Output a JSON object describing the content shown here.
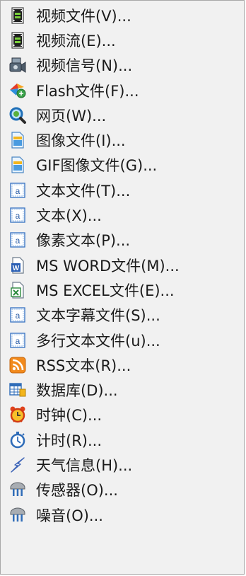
{
  "menu": {
    "items": [
      {
        "label": "视频文件(V)...",
        "icon": "video-file-icon"
      },
      {
        "label": "视频流(E)...",
        "icon": "video-stream-icon"
      },
      {
        "label": "视频信号(N)...",
        "icon": "video-signal-icon"
      },
      {
        "label": "Flash文件(F)...",
        "icon": "flash-file-icon"
      },
      {
        "label": "网页(W)...",
        "icon": "web-page-icon"
      },
      {
        "label": "图像文件(I)...",
        "icon": "image-file-icon"
      },
      {
        "label": "GIF图像文件(G)...",
        "icon": "gif-file-icon"
      },
      {
        "label": "文本文件(T)...",
        "icon": "text-file-icon"
      },
      {
        "label": "文本(X)...",
        "icon": "text-icon"
      },
      {
        "label": "像素文本(P)...",
        "icon": "pixel-text-icon"
      },
      {
        "label": "MS WORD文件(M)...",
        "icon": "word-file-icon"
      },
      {
        "label": "MS EXCEL文件(E)...",
        "icon": "excel-file-icon"
      },
      {
        "label": "文本字幕文件(S)...",
        "icon": "subtitle-file-icon"
      },
      {
        "label": "多行文本文件(u)...",
        "icon": "multiline-text-file-icon"
      },
      {
        "label": "RSS文本(R)...",
        "icon": "rss-icon"
      },
      {
        "label": "数据库(D)...",
        "icon": "database-icon"
      },
      {
        "label": "时钟(C)...",
        "icon": "alarm-clock-icon"
      },
      {
        "label": "计时(R)...",
        "icon": "stopwatch-icon"
      },
      {
        "label": "天气信息(H)...",
        "icon": "weather-icon"
      },
      {
        "label": "传感器(O)...",
        "icon": "sensor-icon"
      },
      {
        "label": "噪音(O)...",
        "icon": "noise-icon"
      }
    ]
  }
}
